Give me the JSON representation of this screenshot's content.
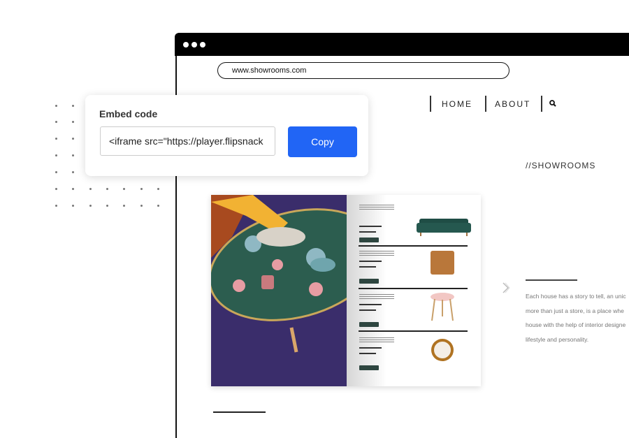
{
  "browser": {
    "url": "www.showrooms.com"
  },
  "nav": {
    "items": [
      {
        "label": "HOME"
      },
      {
        "label": "ABOUT"
      }
    ],
    "search_icon": "search-icon"
  },
  "section_title": "//SHOWROOMS",
  "embed_card": {
    "title": "Embed code",
    "code_value": "<iframe src=\"https://player.flipsnack",
    "copy_label": "Copy",
    "accent": "#2165f5"
  },
  "description": [
    "Each house has a story to tell, an unic",
    "more than just a store, is a place whe",
    "house with the help of interior designe",
    "lifestyle and personality."
  ],
  "catalog": {
    "products": [
      "sofa",
      "pillow",
      "side-table",
      "mirror"
    ]
  }
}
